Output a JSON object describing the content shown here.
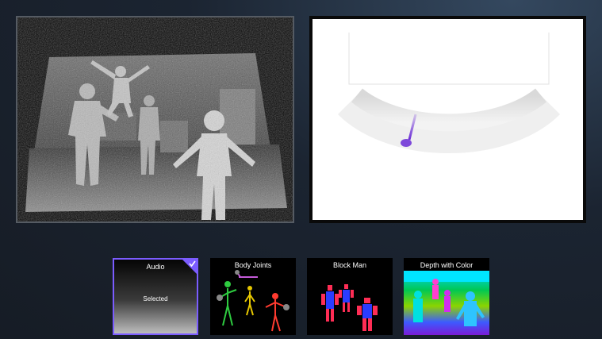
{
  "views": {
    "depth": {
      "label": "depth-point-cloud"
    },
    "audio": {
      "label": "audio-beam-direction"
    }
  },
  "thumbnails": [
    {
      "id": "audio",
      "title": "Audio",
      "status": "Selected",
      "selected": true
    },
    {
      "id": "joints",
      "title": "Body Joints",
      "selected": false
    },
    {
      "id": "block",
      "title": "Block Man",
      "selected": false
    },
    {
      "id": "color",
      "title": "Depth with Color",
      "selected": false
    }
  ],
  "colors": {
    "selection_border": "#7b5cff",
    "beam_color": "#6a2bd6"
  }
}
